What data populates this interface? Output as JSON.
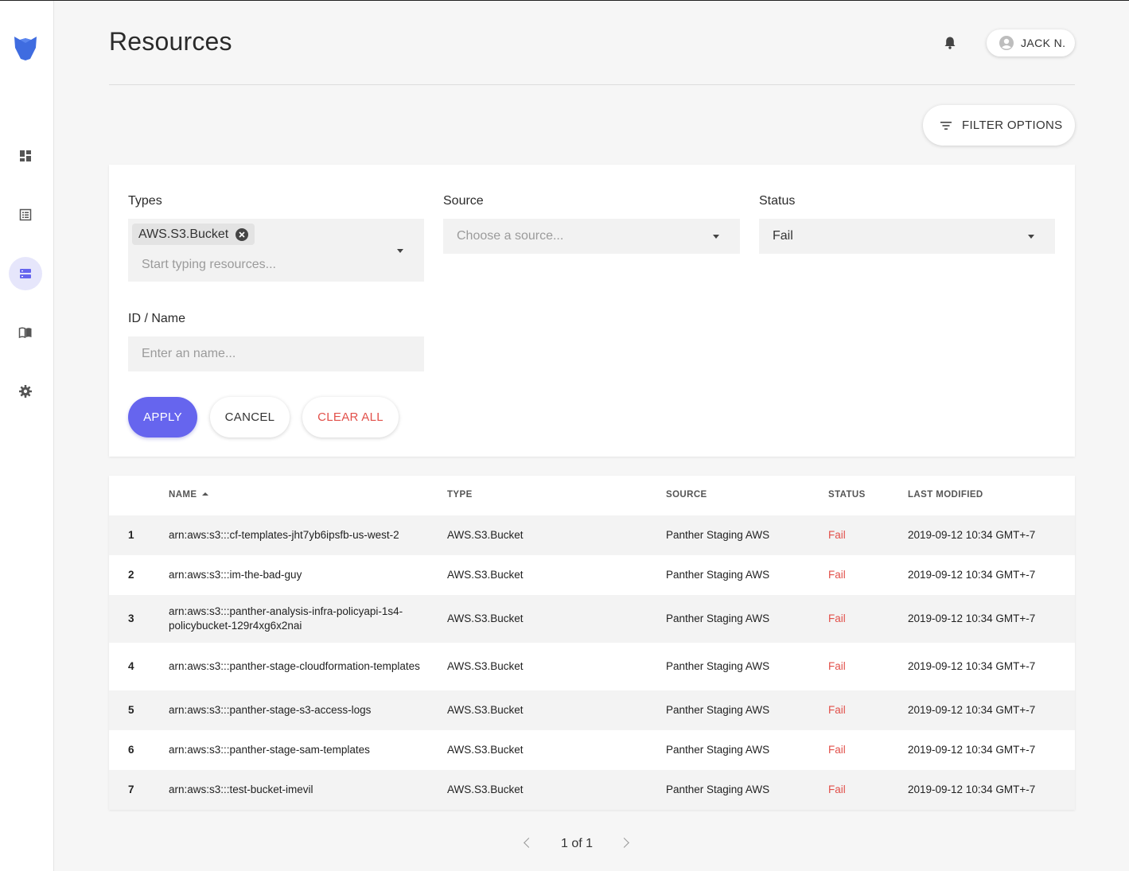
{
  "header": {
    "title": "Resources",
    "user_name": "JACK N."
  },
  "toolbar": {
    "filter_options_label": "FILTER OPTIONS"
  },
  "sidebar": {
    "items": [
      {
        "icon": "dashboard-icon"
      },
      {
        "icon": "policies-list-icon"
      },
      {
        "icon": "resources-icon",
        "active": true
      },
      {
        "icon": "docs-book-icon"
      },
      {
        "icon": "settings-gear-icon"
      }
    ]
  },
  "filters": {
    "types": {
      "label": "Types",
      "chip": "AWS.S3.Bucket",
      "placeholder": "Start typing resources..."
    },
    "source": {
      "label": "Source",
      "placeholder": "Choose a source..."
    },
    "status": {
      "label": "Status",
      "value": "Fail"
    },
    "id_name": {
      "label": "ID / Name",
      "placeholder": "Enter an name..."
    },
    "buttons": {
      "apply": "APPLY",
      "cancel": "CANCEL",
      "clear_all": "CLEAR ALL"
    }
  },
  "table": {
    "columns": [
      "NAME",
      "TYPE",
      "SOURCE",
      "STATUS",
      "LAST MODIFIED"
    ],
    "sort": {
      "column": "NAME",
      "direction": "ascending"
    },
    "rows": [
      {
        "idx": "1",
        "name": "arn:aws:s3:::cf-templates-jht7yb6ipsfb-us-west-2",
        "type": "AWS.S3.Bucket",
        "source": "Panther Staging AWS",
        "status": "Fail",
        "modified": "2019-09-12 10:34 GMT+-7"
      },
      {
        "idx": "2",
        "name": "arn:aws:s3:::im-the-bad-guy",
        "type": "AWS.S3.Bucket",
        "source": "Panther Staging AWS",
        "status": "Fail",
        "modified": "2019-09-12 10:34 GMT+-7"
      },
      {
        "idx": "3",
        "name": "arn:aws:s3:::panther-analysis-infra-policyapi-1s4-policybucket-129r4xg6x2nai",
        "type": "AWS.S3.Bucket",
        "source": "Panther Staging AWS",
        "status": "Fail",
        "modified": "2019-09-12 10:34 GMT+-7"
      },
      {
        "idx": "4",
        "name": "arn:aws:s3:::panther-stage-cloudformation-templates",
        "type": "AWS.S3.Bucket",
        "source": "Panther Staging AWS",
        "status": "Fail",
        "modified": "2019-09-12 10:34 GMT+-7"
      },
      {
        "idx": "5",
        "name": "arn:aws:s3:::panther-stage-s3-access-logs",
        "type": "AWS.S3.Bucket",
        "source": "Panther Staging AWS",
        "status": "Fail",
        "modified": "2019-09-12 10:34 GMT+-7"
      },
      {
        "idx": "6",
        "name": "arn:aws:s3:::panther-stage-sam-templates",
        "type": "AWS.S3.Bucket",
        "source": "Panther Staging AWS",
        "status": "Fail",
        "modified": "2019-09-12 10:34 GMT+-7"
      },
      {
        "idx": "7",
        "name": "arn:aws:s3:::test-bucket-imevil",
        "type": "AWS.S3.Bucket",
        "source": "Panther Staging AWS",
        "status": "Fail",
        "modified": "2019-09-12 10:34 GMT+-7"
      }
    ]
  },
  "pagination": {
    "text": "1 of 1"
  },
  "colors": {
    "accent": "#6665ee",
    "fail": "#e2504a",
    "logo": "#3f6ce0"
  }
}
